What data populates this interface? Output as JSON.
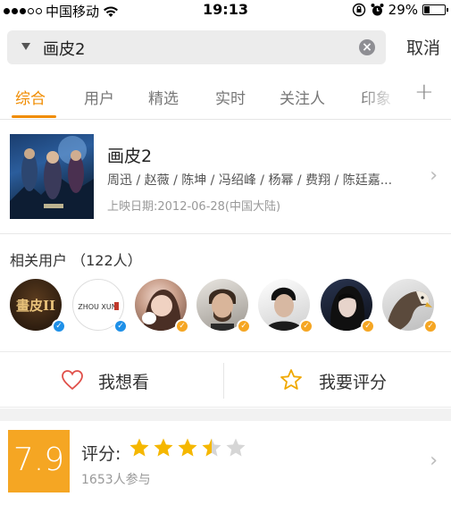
{
  "status_bar": {
    "carrier": "中国移动",
    "time": "19:13",
    "battery": "29%",
    "battery_level": 0.29
  },
  "search": {
    "query": "画皮2",
    "cancel_label": "取消"
  },
  "tabs": [
    {
      "label": "综合",
      "active": true
    },
    {
      "label": "用户",
      "active": false
    },
    {
      "label": "精选",
      "active": false
    },
    {
      "label": "实时",
      "active": false
    },
    {
      "label": "关注人",
      "active": false
    },
    {
      "label": "印象",
      "active": false
    }
  ],
  "movie": {
    "title": "画皮2",
    "cast": "周迅 / 赵薇 / 陈坤 / 冯绍峰 / 杨幂 / 费翔 / 陈廷嘉...",
    "release": "上映日期:2012-06-28(中国大陆)"
  },
  "related_users": {
    "label": "相关用户 （122人）",
    "avatars": [
      {
        "icon": "movie-poster-avatar",
        "badge": "blue",
        "logo_text": "畫皮II"
      },
      {
        "icon": "zhou-xun-avatar",
        "badge": "blue",
        "logo_text": "ZHOU XUN"
      },
      {
        "icon": "person-avatar",
        "badge": "gold"
      },
      {
        "icon": "person-avatar",
        "badge": "gold"
      },
      {
        "icon": "person-avatar",
        "badge": "gold"
      },
      {
        "icon": "person-avatar",
        "badge": "gold"
      },
      {
        "icon": "eagle-avatar",
        "badge": "gold"
      }
    ]
  },
  "actions": {
    "want_label": "我想看",
    "rate_label": "我要评分"
  },
  "rating": {
    "score": "7.9",
    "label": "评分:",
    "stars": 3.5,
    "count": "1653人参与"
  },
  "colors": {
    "accent": "#f08c00",
    "score_bg": "#f5a623",
    "star": "#f5b700",
    "badge_blue": "#1e90e8",
    "badge_gold": "#f5a623"
  }
}
